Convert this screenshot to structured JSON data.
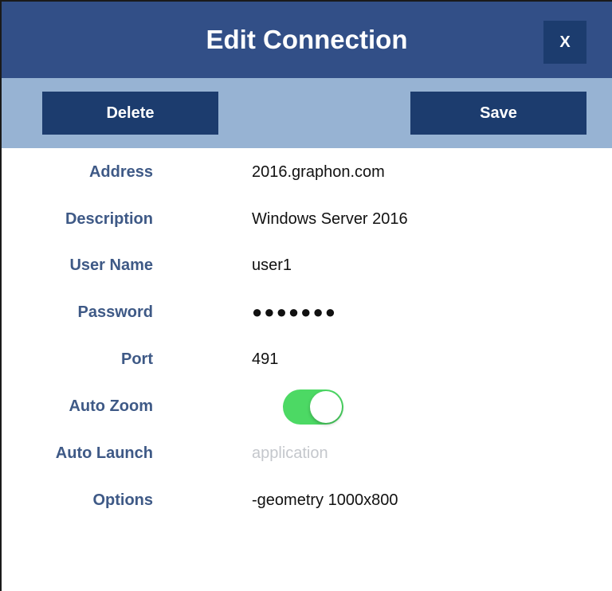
{
  "header": {
    "title": "Edit Connection",
    "close_label": "X"
  },
  "toolbar": {
    "delete_label": "Delete",
    "save_label": "Save"
  },
  "form": {
    "address": {
      "label": "Address",
      "value": "2016.graphon.com"
    },
    "description": {
      "label": "Description",
      "value": "Windows Server 2016"
    },
    "username": {
      "label": "User Name",
      "value": "user1"
    },
    "password": {
      "label": "Password",
      "value": "●●●●●●●"
    },
    "port": {
      "label": "Port",
      "value": "491"
    },
    "auto_zoom": {
      "label": "Auto Zoom",
      "on": true
    },
    "auto_launch": {
      "label": "Auto Launch",
      "value": "",
      "placeholder": "application"
    },
    "options": {
      "label": "Options",
      "value": "-geometry 1000x800"
    }
  },
  "colors": {
    "titlebar": "#324f87",
    "toolbar": "#97b3d3",
    "button": "#1c3c6e",
    "label": "#3e5986",
    "toggle_on": "#4cd964"
  }
}
